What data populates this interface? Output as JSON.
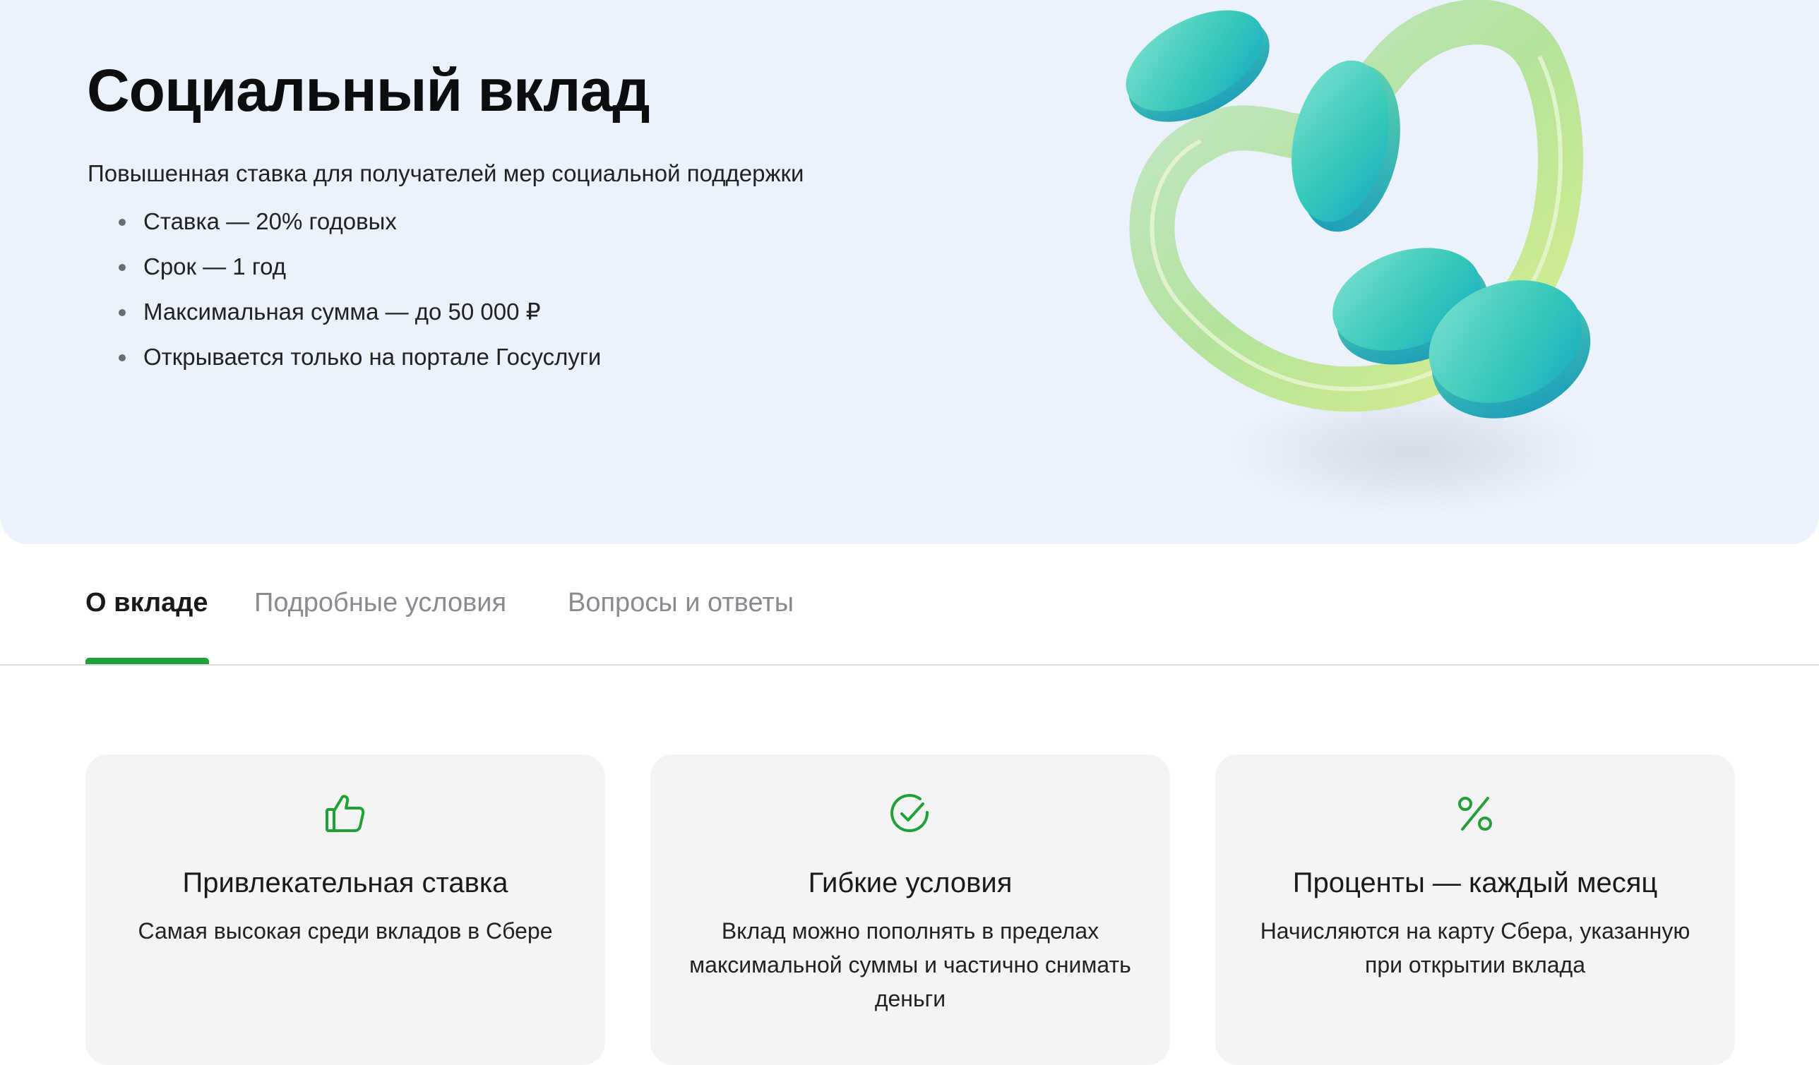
{
  "hero": {
    "title": "Социальный вклад",
    "subtitle": "Повышенная ставка для получателей мер социальной поддержки",
    "bullets": [
      "Ставка — 20% годовых",
      "Срок — 1 год",
      "Максимальная сумма — до 50 000 ₽",
      "Открывается только на портале Госуслуги"
    ]
  },
  "tabs": [
    {
      "label": "О вкладе",
      "active": true
    },
    {
      "label": "Подробные условия",
      "active": false
    },
    {
      "label": "Вопросы и ответы",
      "active": false
    }
  ],
  "cards": [
    {
      "icon": "thumbs-up-icon",
      "title": "Привлекательная ставка",
      "text": "Самая высокая среди вкладов в Сбере"
    },
    {
      "icon": "check-circle-icon",
      "title": "Гибкие условия",
      "text": "Вклад можно пополнять в пределах максимальной суммы и частично снимать деньги"
    },
    {
      "icon": "percent-icon",
      "title": "Проценты — каждый месяц",
      "text": "Начисляются на карту Сбера, указанную при открытии вклада"
    }
  ],
  "colors": {
    "accent": "#21a038",
    "hero_background": "#ecf2fc",
    "card_background": "#f4f4f5"
  }
}
